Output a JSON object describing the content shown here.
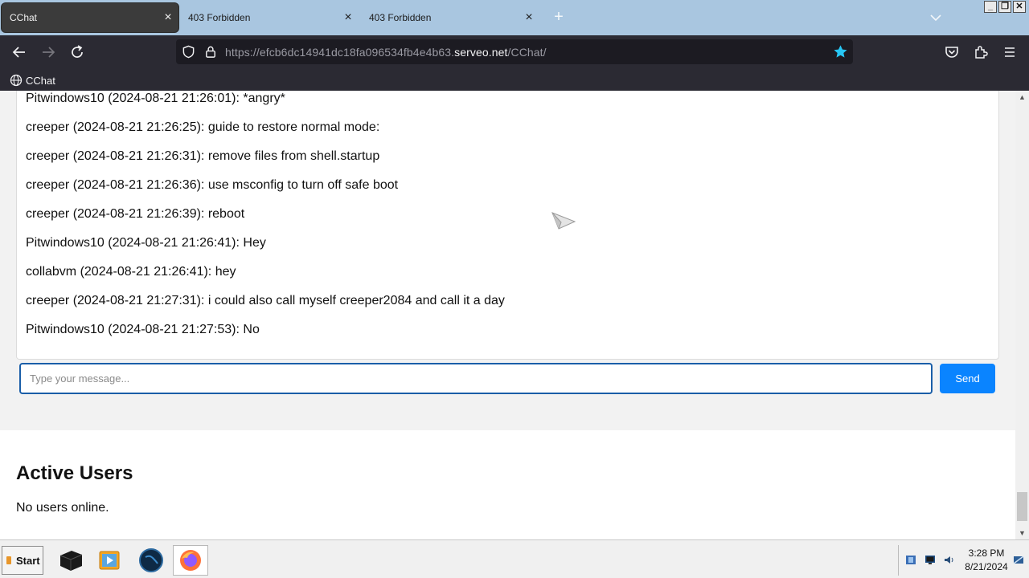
{
  "browser": {
    "tabs": [
      {
        "label": "CChat",
        "active": true
      },
      {
        "label": "403 Forbidden",
        "active": false
      },
      {
        "label": "403 Forbidden",
        "active": false
      }
    ],
    "url": {
      "prefix": "https://efcb6dc14941dc18fa096534fb4e4b63.",
      "host": "serveo.net",
      "path": "/CChat/"
    },
    "bookmarks": [
      {
        "label": "CChat",
        "icon": "globe-icon"
      }
    ],
    "window_controls": {
      "minimize": "_",
      "restore": "❐",
      "close": "✕"
    }
  },
  "chat": {
    "messages": [
      "Pitwindows10 (2024-08-21 21:26:01): *angry*",
      "creeper (2024-08-21 21:26:25): guide to restore normal mode:",
      "creeper (2024-08-21 21:26:31): remove files from shell.startup",
      "creeper (2024-08-21 21:26:36): use msconfig to turn off safe boot",
      "creeper (2024-08-21 21:26:39): reboot",
      "Pitwindows10 (2024-08-21 21:26:41): Hey",
      "collabvm (2024-08-21 21:26:41): hey",
      "creeper (2024-08-21 21:27:31): i could also call myself creeper2084 and call it a day",
      "Pitwindows10 (2024-08-21 21:27:53): No"
    ],
    "input_placeholder": "Type your message...",
    "input_value": "",
    "send_label": "Send"
  },
  "active_users": {
    "title": "Active Users",
    "status": "No users online."
  },
  "taskbar": {
    "start_label": "Start",
    "clock_time": "3:28 PM",
    "clock_date": "8/21/2024"
  },
  "colors": {
    "tabstrip": "#a9c6e0",
    "toolbar": "#2b2a33",
    "urlbar": "#1c1b22",
    "send_button": "#0a84ff",
    "input_border": "#1a5ea8",
    "bookmark_star": "#27c6f4"
  }
}
